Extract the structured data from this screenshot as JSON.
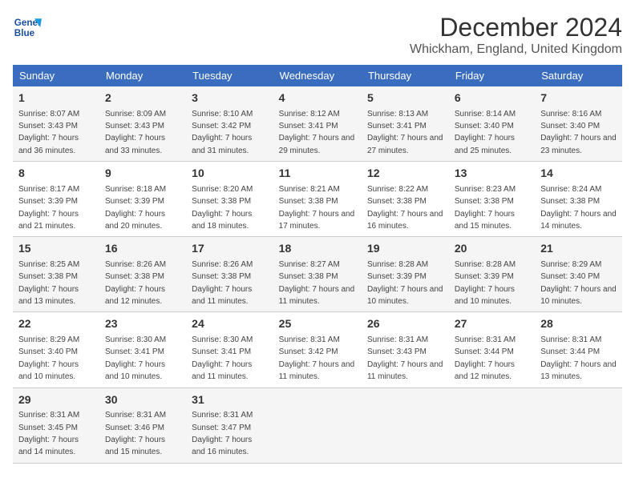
{
  "header": {
    "logo_line1": "General",
    "logo_line2": "Blue",
    "month": "December 2024",
    "location": "Whickham, England, United Kingdom"
  },
  "days_of_week": [
    "Sunday",
    "Monday",
    "Tuesday",
    "Wednesday",
    "Thursday",
    "Friday",
    "Saturday"
  ],
  "weeks": [
    [
      {
        "day": "1",
        "sunrise": "8:07 AM",
        "sunset": "3:43 PM",
        "daylight": "7 hours and 36 minutes."
      },
      {
        "day": "2",
        "sunrise": "8:09 AM",
        "sunset": "3:43 PM",
        "daylight": "7 hours and 33 minutes."
      },
      {
        "day": "3",
        "sunrise": "8:10 AM",
        "sunset": "3:42 PM",
        "daylight": "7 hours and 31 minutes."
      },
      {
        "day": "4",
        "sunrise": "8:12 AM",
        "sunset": "3:41 PM",
        "daylight": "7 hours and 29 minutes."
      },
      {
        "day": "5",
        "sunrise": "8:13 AM",
        "sunset": "3:41 PM",
        "daylight": "7 hours and 27 minutes."
      },
      {
        "day": "6",
        "sunrise": "8:14 AM",
        "sunset": "3:40 PM",
        "daylight": "7 hours and 25 minutes."
      },
      {
        "day": "7",
        "sunrise": "8:16 AM",
        "sunset": "3:40 PM",
        "daylight": "7 hours and 23 minutes."
      }
    ],
    [
      {
        "day": "8",
        "sunrise": "8:17 AM",
        "sunset": "3:39 PM",
        "daylight": "7 hours and 21 minutes."
      },
      {
        "day": "9",
        "sunrise": "8:18 AM",
        "sunset": "3:39 PM",
        "daylight": "7 hours and 20 minutes."
      },
      {
        "day": "10",
        "sunrise": "8:20 AM",
        "sunset": "3:38 PM",
        "daylight": "7 hours and 18 minutes."
      },
      {
        "day": "11",
        "sunrise": "8:21 AM",
        "sunset": "3:38 PM",
        "daylight": "7 hours and 17 minutes."
      },
      {
        "day": "12",
        "sunrise": "8:22 AM",
        "sunset": "3:38 PM",
        "daylight": "7 hours and 16 minutes."
      },
      {
        "day": "13",
        "sunrise": "8:23 AM",
        "sunset": "3:38 PM",
        "daylight": "7 hours and 15 minutes."
      },
      {
        "day": "14",
        "sunrise": "8:24 AM",
        "sunset": "3:38 PM",
        "daylight": "7 hours and 14 minutes."
      }
    ],
    [
      {
        "day": "15",
        "sunrise": "8:25 AM",
        "sunset": "3:38 PM",
        "daylight": "7 hours and 13 minutes."
      },
      {
        "day": "16",
        "sunrise": "8:26 AM",
        "sunset": "3:38 PM",
        "daylight": "7 hours and 12 minutes."
      },
      {
        "day": "17",
        "sunrise": "8:26 AM",
        "sunset": "3:38 PM",
        "daylight": "7 hours and 11 minutes."
      },
      {
        "day": "18",
        "sunrise": "8:27 AM",
        "sunset": "3:38 PM",
        "daylight": "7 hours and 11 minutes."
      },
      {
        "day": "19",
        "sunrise": "8:28 AM",
        "sunset": "3:39 PM",
        "daylight": "7 hours and 10 minutes."
      },
      {
        "day": "20",
        "sunrise": "8:28 AM",
        "sunset": "3:39 PM",
        "daylight": "7 hours and 10 minutes."
      },
      {
        "day": "21",
        "sunrise": "8:29 AM",
        "sunset": "3:40 PM",
        "daylight": "7 hours and 10 minutes."
      }
    ],
    [
      {
        "day": "22",
        "sunrise": "8:29 AM",
        "sunset": "3:40 PM",
        "daylight": "7 hours and 10 minutes."
      },
      {
        "day": "23",
        "sunrise": "8:30 AM",
        "sunset": "3:41 PM",
        "daylight": "7 hours and 10 minutes."
      },
      {
        "day": "24",
        "sunrise": "8:30 AM",
        "sunset": "3:41 PM",
        "daylight": "7 hours and 11 minutes."
      },
      {
        "day": "25",
        "sunrise": "8:31 AM",
        "sunset": "3:42 PM",
        "daylight": "7 hours and 11 minutes."
      },
      {
        "day": "26",
        "sunrise": "8:31 AM",
        "sunset": "3:43 PM",
        "daylight": "7 hours and 11 minutes."
      },
      {
        "day": "27",
        "sunrise": "8:31 AM",
        "sunset": "3:44 PM",
        "daylight": "7 hours and 12 minutes."
      },
      {
        "day": "28",
        "sunrise": "8:31 AM",
        "sunset": "3:44 PM",
        "daylight": "7 hours and 13 minutes."
      }
    ],
    [
      {
        "day": "29",
        "sunrise": "8:31 AM",
        "sunset": "3:45 PM",
        "daylight": "7 hours and 14 minutes."
      },
      {
        "day": "30",
        "sunrise": "8:31 AM",
        "sunset": "3:46 PM",
        "daylight": "7 hours and 15 minutes."
      },
      {
        "day": "31",
        "sunrise": "8:31 AM",
        "sunset": "3:47 PM",
        "daylight": "7 hours and 16 minutes."
      },
      null,
      null,
      null,
      null
    ]
  ],
  "labels": {
    "sunrise": "Sunrise: ",
    "sunset": "Sunset: ",
    "daylight": "Daylight: "
  }
}
